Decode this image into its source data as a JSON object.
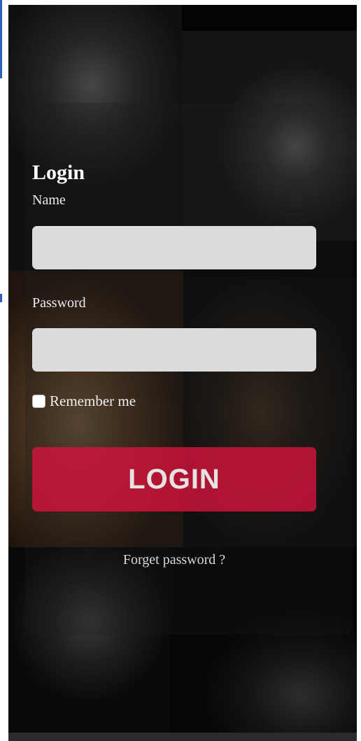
{
  "login": {
    "title": "Login",
    "name_label": "Name",
    "name_value": "",
    "password_label": "Password",
    "password_value": "",
    "remember_label": "Remember me",
    "button_label": "LOGIN",
    "forgot_label": "Forget password ?"
  },
  "colors": {
    "button": "#d2143a",
    "input_bg": "#dcdcdc",
    "text": "#ffffff"
  }
}
